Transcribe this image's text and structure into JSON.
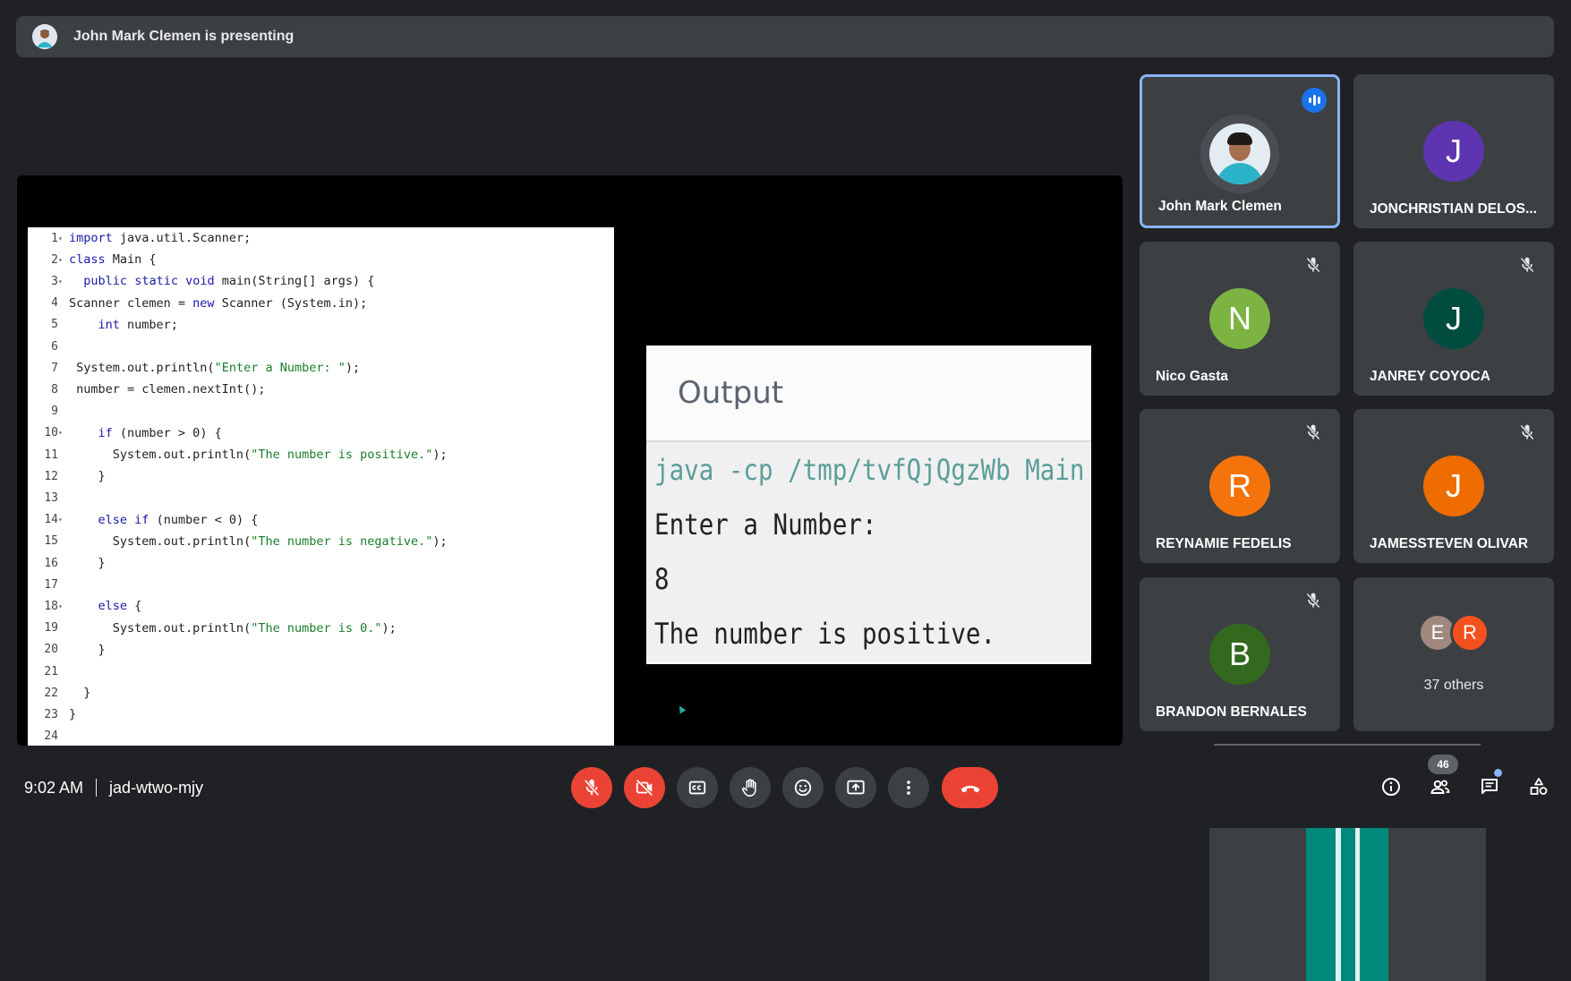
{
  "banner": {
    "text": "John Mark Clemen is presenting"
  },
  "code": {
    "lines": [
      {
        "n": "1",
        "fold": true,
        "text": "import java.util.Scanner;"
      },
      {
        "n": "2",
        "fold": true,
        "text": "class Main {"
      },
      {
        "n": "3",
        "fold": true,
        "text": "  public static void main(String[] args) {"
      },
      {
        "n": "4",
        "fold": false,
        "text": "Scanner clemen = new Scanner (System.in);"
      },
      {
        "n": "5",
        "fold": false,
        "text": "    int number;"
      },
      {
        "n": "6",
        "fold": false,
        "text": ""
      },
      {
        "n": "7",
        "fold": false,
        "text": " System.out.println(\"Enter a Number: \");"
      },
      {
        "n": "8",
        "fold": false,
        "text": " number = clemen.nextInt();"
      },
      {
        "n": "9",
        "fold": false,
        "text": ""
      },
      {
        "n": "10",
        "fold": true,
        "text": "    if (number > 0) {"
      },
      {
        "n": "11",
        "fold": false,
        "text": "      System.out.println(\"The number is positive.\");"
      },
      {
        "n": "12",
        "fold": false,
        "text": "    }"
      },
      {
        "n": "13",
        "fold": false,
        "text": ""
      },
      {
        "n": "14",
        "fold": true,
        "text": "    else if (number < 0) {"
      },
      {
        "n": "15",
        "fold": false,
        "text": "      System.out.println(\"The number is negative.\");"
      },
      {
        "n": "16",
        "fold": false,
        "text": "    }"
      },
      {
        "n": "17",
        "fold": false,
        "text": ""
      },
      {
        "n": "18",
        "fold": true,
        "text": "    else {"
      },
      {
        "n": "19",
        "fold": false,
        "text": "      System.out.println(\"The number is 0.\");"
      },
      {
        "n": "20",
        "fold": false,
        "text": "    }"
      },
      {
        "n": "21",
        "fold": false,
        "text": ""
      },
      {
        "n": "22",
        "fold": false,
        "text": "  }"
      },
      {
        "n": "23",
        "fold": false,
        "text": "}"
      },
      {
        "n": "24",
        "fold": false,
        "text": ""
      }
    ]
  },
  "output": {
    "title": "Output",
    "command": "java -cp /tmp/tvfQjQgzWb Main",
    "lines": [
      "Enter a Number:",
      "8",
      "The number is positive."
    ]
  },
  "participants": [
    {
      "name": "John Mark Clemen",
      "initial": "",
      "color": "",
      "photo": true,
      "speaking": true,
      "muted": false
    },
    {
      "name": "JONCHRISTIAN DELOS...",
      "initial": "J",
      "color": "#5e35b1",
      "photo": false,
      "speaking": false,
      "muted": false
    },
    {
      "name": "Nico Gasta",
      "initial": "N",
      "color": "#7cb342",
      "photo": false,
      "speaking": false,
      "muted": true
    },
    {
      "name": "JANREY COYOCA",
      "initial": "J",
      "color": "#004d40",
      "photo": false,
      "speaking": false,
      "muted": true
    },
    {
      "name": "REYNAMIE FEDELIS",
      "initial": "R",
      "color": "#f4730b",
      "photo": false,
      "speaking": false,
      "muted": true
    },
    {
      "name": "JAMESSTEVEN OLIVAR",
      "initial": "J",
      "color": "#ef6c00",
      "photo": false,
      "speaking": false,
      "muted": true
    },
    {
      "name": "BRANDON BERNALES",
      "initial": "B",
      "color": "#33691e",
      "photo": false,
      "speaking": false,
      "muted": true
    }
  ],
  "others": {
    "label": "37 others",
    "avatars": [
      {
        "initial": "E",
        "color": "#a1887f"
      },
      {
        "initial": "R",
        "color": "#f4511e"
      }
    ]
  },
  "meeting": {
    "time": "9:02 AM",
    "code": "jad-wtwo-mjy"
  },
  "controls": [
    "mic-off",
    "camera-off",
    "captions",
    "raise-hand",
    "emoji",
    "present",
    "more",
    "end-call"
  ],
  "people_count": "46",
  "colors": {
    "background": "#202124",
    "tile": "#3c4043",
    "danger": "#ea4335",
    "active_border": "#8ab4f8",
    "accent_blue": "#1a73e8"
  }
}
